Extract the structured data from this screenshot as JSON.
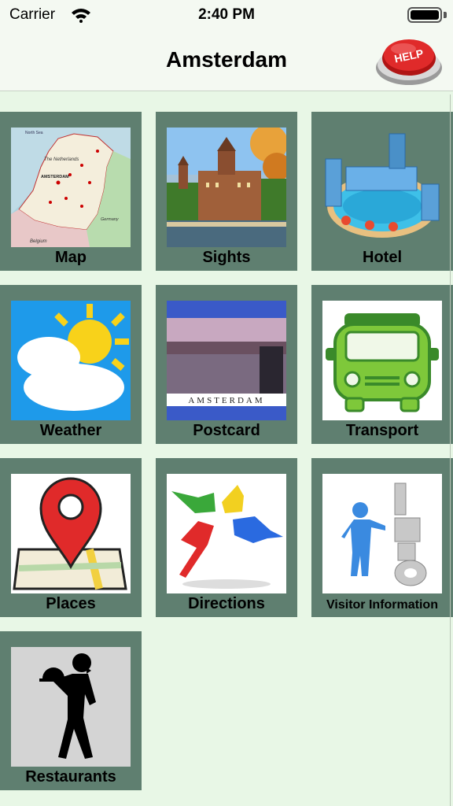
{
  "status_bar": {
    "carrier": "Carrier",
    "time": "2:40 PM"
  },
  "nav": {
    "title": "Amsterdam",
    "help_label": "HELP"
  },
  "tiles": [
    {
      "label": "Map",
      "icon": "netherlands-map-icon"
    },
    {
      "label": "Sights",
      "icon": "sights-photo-icon"
    },
    {
      "label": "Hotel",
      "icon": "hotel-icon"
    },
    {
      "label": "Weather",
      "icon": "weather-icon"
    },
    {
      "label": "Postcard",
      "icon": "postcard-icon"
    },
    {
      "label": "Transport",
      "icon": "transport-icon"
    },
    {
      "label": "Places",
      "icon": "map-pin-icon"
    },
    {
      "label": "Directions",
      "icon": "pointing-hands-icon"
    },
    {
      "label": "Visitor Information",
      "icon": "info-figure-icon"
    },
    {
      "label": "Restaurants",
      "icon": "waiter-icon"
    }
  ],
  "map_labels": {
    "country": "The Netherlands",
    "city": "AMSTERDAM",
    "germany": "Germany",
    "belgium": "Belgium",
    "north_sea": "North Sea"
  },
  "postcard_caption": "AMSTERDAM",
  "colors": {
    "tile_bg": "#5f7f70",
    "page_bg": "#e8f7e6",
    "bar_bg": "#f4f9f2"
  }
}
